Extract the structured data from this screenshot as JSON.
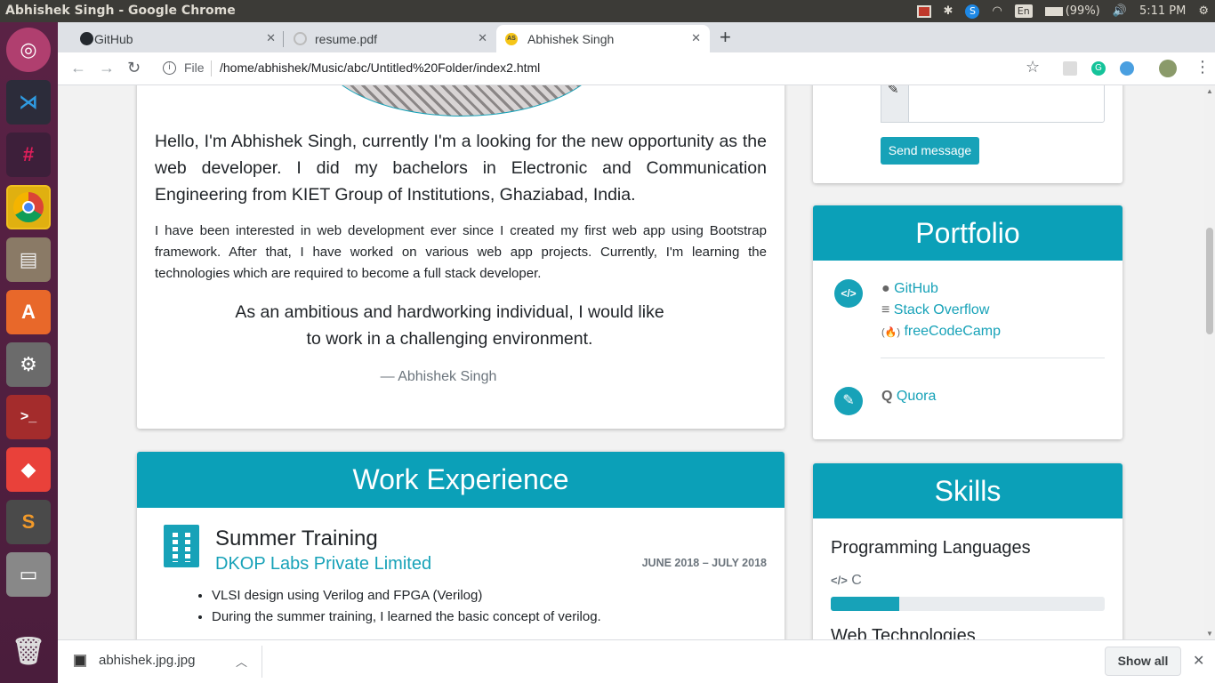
{
  "window": {
    "title": "Abhishek Singh - Google Chrome"
  },
  "tray": {
    "lang": "En",
    "battery": "(99%)",
    "time": "5:11 PM"
  },
  "tabs": [
    {
      "label": "GitHub"
    },
    {
      "label": "resume.pdf"
    },
    {
      "label": "Abhishek Singh"
    }
  ],
  "omnibox": {
    "scheme": "File",
    "url": "/home/abhishek/Music/abc/Untitled%20Folder/index2.html"
  },
  "about": {
    "intro": "Hello, I'm Abhishek Singh, currently I'm a looking for the new opportunity as the web developer. I did my bachelors in Electronic and Communication Engineering from KIET Group of Institutions, Ghaziabad, India.",
    "paragraph": "I have been interested in web development ever since I created my first web app using Bootstrap framework. After that, I have worked on various web app projects. Currently, I'm learning the technologies which are required to become a full stack developer.",
    "quote_line1": "As an ambitious and hardworking individual, I would like",
    "quote_line2": "to work in a challenging environment.",
    "quote_author": "— Abhishek Singh"
  },
  "work": {
    "heading": "Work Experience",
    "job_title": "Summer Training",
    "company": "DKOP Labs Private Limited",
    "dates": "JUNE 2018 – JULY 2018",
    "bullets": [
      "VLSI design using Verilog and FPGA (Verilog)",
      "During the summer training, I learned the basic concept of verilog."
    ]
  },
  "contact": {
    "send_label": "Send message"
  },
  "portfolio": {
    "heading": "Portfolio",
    "links": [
      "GitHub",
      "Stack Overflow",
      "freeCodeCamp"
    ],
    "quora": "Quora"
  },
  "skills": {
    "heading": "Skills",
    "section1": "Programming Languages",
    "skill1": "C",
    "skill1_level": 0.25,
    "section2": "Web Technologies"
  },
  "download": {
    "file": "abhishek.jpg.jpg",
    "show_all": "Show all"
  },
  "colors": {
    "accent": "#17a2b8",
    "header": "#0ba0b8",
    "launcher": "#4a1d3c"
  }
}
